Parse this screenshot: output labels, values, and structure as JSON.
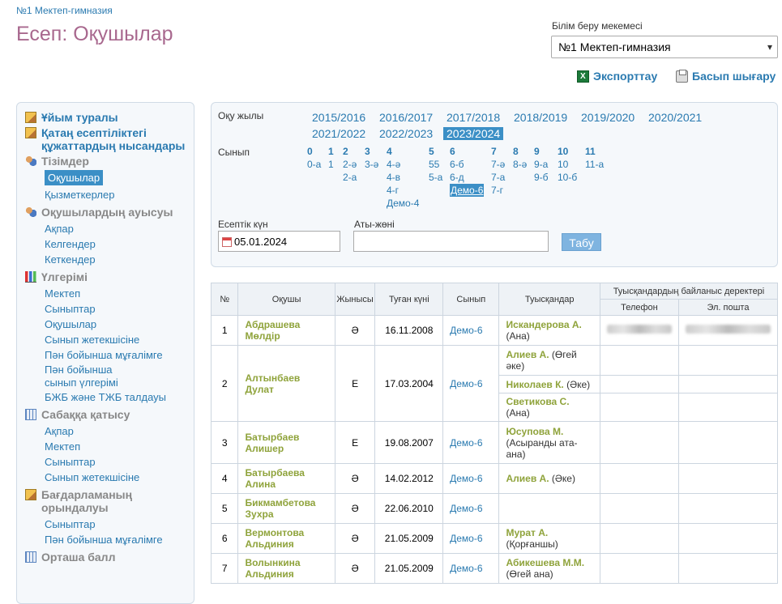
{
  "breadcrumb": "№1 Мектеп-гимназия",
  "title": "Есеп: Оқушылар",
  "org": {
    "label": "Білім беру мекемесі",
    "value": "№1 Мектеп-гимназия"
  },
  "toolbar": {
    "export": "Экспорттау",
    "print": "Басып шығару"
  },
  "sidebar": {
    "groups": [
      {
        "title": "Ұйым туралы",
        "icon": "pencil-icon",
        "items": []
      },
      {
        "title": "Қатаң есептіліктегі құжаттардың нысандары",
        "icon": "pencil-icon",
        "items": []
      },
      {
        "title": "Тізімдер",
        "icon": "users-icon",
        "items": [
          "Оқушылар",
          "Қызметкерлер"
        ],
        "active": "Оқушылар"
      },
      {
        "title": "Оқушылардың ауысуы",
        "icon": "users-icon",
        "items": [
          "Ақпар",
          "Келгендер",
          "Кеткендер"
        ]
      },
      {
        "title": "Үлгерімі",
        "icon": "bar-chart-icon",
        "items": [
          "Мектеп",
          "Сыныптар",
          "Оқушылар",
          "Сынып жетекшісіне",
          "Пән бойынша мұғалімге",
          "Пән бойынша сынып үлгерімі",
          "БЖБ және ТЖБ талдауы"
        ]
      },
      {
        "title": "Сабаққа қатысу",
        "icon": "calendar-grid-icon",
        "items": [
          "Ақпар",
          "Мектеп",
          "Сыныптар",
          "Сынып жетекшісіне"
        ]
      },
      {
        "title": "Бағдарламаның орындалуы",
        "icon": "pencil-icon",
        "items": [
          "Сыныптар",
          "Пән бойынша мұғалімге"
        ]
      },
      {
        "title": "Орташа балл",
        "icon": "calendar-grid-icon",
        "items": []
      }
    ]
  },
  "filters": {
    "year_label": "Оқу жылы",
    "years": [
      "2015/2016",
      "2016/2017",
      "2017/2018",
      "2018/2019",
      "2019/2020",
      "2020/2021",
      "2021/2022",
      "2022/2023",
      "2023/2024"
    ],
    "active_year": "2023/2024",
    "class_label": "Сынып",
    "grades": [
      {
        "grade": "0",
        "subs": [
          "0-а"
        ]
      },
      {
        "grade": "1",
        "subs": [
          "1"
        ]
      },
      {
        "grade": "2",
        "subs": [
          "2-ә",
          "2-а"
        ]
      },
      {
        "grade": "3",
        "subs": [
          "3-ә"
        ]
      },
      {
        "grade": "4",
        "subs": [
          "4-ә",
          "4-в",
          "4-г",
          "Демо-4"
        ]
      },
      {
        "grade": "5",
        "subs": [
          "55",
          "5-а"
        ]
      },
      {
        "grade": "6",
        "subs": [
          "6-б",
          "6-д",
          "Демо-6"
        ]
      },
      {
        "grade": "7",
        "subs": [
          "7-ә",
          "7-а",
          "7-г"
        ]
      },
      {
        "grade": "8",
        "subs": [
          "8-ә"
        ]
      },
      {
        "grade": "9",
        "subs": [
          "9-а",
          "9-б"
        ]
      },
      {
        "grade": "10",
        "subs": [
          "10",
          "10-б"
        ]
      },
      {
        "grade": "11",
        "subs": [
          "11-а"
        ]
      }
    ],
    "active_class": "Демо-6",
    "date_label": "Есептік күн",
    "date_value": "05.01.2024",
    "name_label": "Аты-жөні",
    "name_value": "",
    "search_button": "Табу"
  },
  "table": {
    "headers": {
      "num": "№",
      "student": "Оқушы",
      "gender": "Жынысы",
      "birth": "Туған күні",
      "class": "Сынып",
      "relatives": "Туысқандар",
      "contacts": "Туысқандардың байланыс деректері",
      "phone": "Телефон",
      "email": "Эл. пошта"
    },
    "rows": [
      {
        "num": "1",
        "student": "Абдрашева Мөлдір",
        "gender": "Ә",
        "birth": "16.11.2008",
        "class": "Демо-6",
        "relatives": [
          {
            "name": "Искандерова А.",
            "rel": "(Ана)"
          }
        ]
      },
      {
        "num": "2",
        "student": "Алтынбаев Дулат",
        "gender": "Е",
        "birth": "17.03.2004",
        "class": "Демо-6",
        "relatives": [
          {
            "name": "Алиев А.",
            "rel": "(Өгей әке)"
          },
          {
            "name": "Николаев К.",
            "rel": "(Әке)"
          },
          {
            "name": "Светикова С.",
            "rel": "(Ана)"
          }
        ]
      },
      {
        "num": "3",
        "student": "Батырбаев Алишер",
        "gender": "Е",
        "birth": "19.08.2007",
        "class": "Демо-6",
        "relatives": [
          {
            "name": "Юсупова М.",
            "rel": "(Асыранды ата-ана)"
          }
        ]
      },
      {
        "num": "4",
        "student": "Батырбаева Алина",
        "gender": "Ә",
        "birth": "14.02.2012",
        "class": "Демо-6",
        "relatives": [
          {
            "name": "Алиев А.",
            "rel": "(Әке)"
          }
        ]
      },
      {
        "num": "5",
        "student": "Бикмамбетова Зухра",
        "gender": "Ә",
        "birth": "22.06.2010",
        "class": "Демо-6",
        "relatives": []
      },
      {
        "num": "6",
        "student": "Вермонтова Альдиния",
        "gender": "Ә",
        "birth": "21.05.2009",
        "class": "Демо-6",
        "relatives": [
          {
            "name": "Мурат А.",
            "rel": "(Қорғаншы)"
          }
        ]
      },
      {
        "num": "7",
        "student": "Волынкина Альдиния",
        "gender": "Ә",
        "birth": "21.05.2009",
        "class": "Демо-6",
        "relatives": [
          {
            "name": "Абикешева М.М.",
            "rel": "(Өгей ана)"
          }
        ]
      }
    ]
  }
}
